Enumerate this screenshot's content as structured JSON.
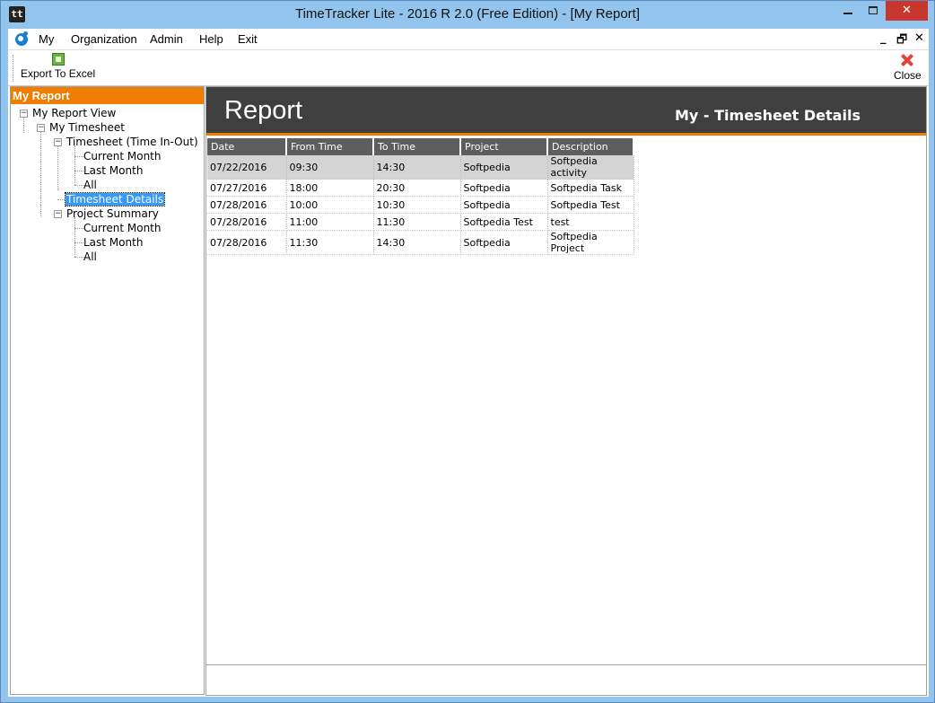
{
  "window": {
    "title": "TimeTracker Lite  - 2016 R 2.0 (Free Edition)  - [My Report]",
    "app_icon_text": "tt",
    "minimize": "–",
    "close": "✕"
  },
  "menu": {
    "items": [
      "My",
      "Organization",
      "Admin",
      "Help",
      "Exit"
    ],
    "mdi_minimize": "_",
    "mdi_restore": "🗗",
    "mdi_close": "✕"
  },
  "toolbar": {
    "export_label": "Export To Excel",
    "close_label": "Close"
  },
  "left": {
    "header": "My Report",
    "tree": [
      "My Report View",
      "My Timesheet",
      "Timesheet (Time In-Out)",
      "Current Month",
      "Last Month",
      "All",
      "Timesheet Details",
      "Project Summary",
      "Current Month",
      "Last Month",
      "All"
    ],
    "toggle_symbol": "−"
  },
  "report": {
    "title": "Report",
    "subtitle": "My - Timesheet Details",
    "columns": [
      "Date",
      "From Time",
      "To Time",
      "Project",
      "Description"
    ],
    "rows": [
      [
        "07/22/2016",
        "09:30",
        "14:30",
        "Softpedia",
        "Softpedia activity"
      ],
      [
        "07/27/2016",
        "18:00",
        "20:30",
        "Softpedia",
        "Softpedia Task"
      ],
      [
        "07/28/2016",
        "10:00",
        "10:30",
        "Softpedia",
        "Softpedia Test"
      ],
      [
        "07/28/2016",
        "11:00",
        "11:30",
        "Softpedia Test",
        "test"
      ],
      [
        "07/28/2016",
        "11:30",
        "14:30",
        "Softpedia",
        "Softpedia Project"
      ]
    ]
  },
  "colors": {
    "accent_orange": "#f07c00",
    "header_dark": "#3f3f3f",
    "selection_blue": "#3399ff"
  }
}
